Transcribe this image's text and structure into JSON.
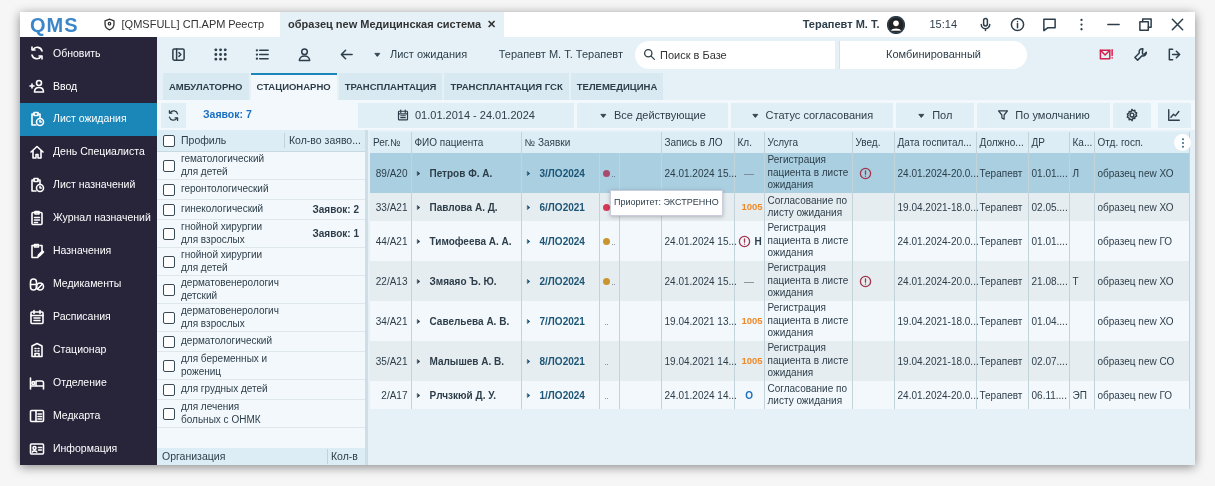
{
  "titlebar": {
    "logo": "QMS",
    "tabs": [
      {
        "label": "[QMSFULL] СП.АРМ Реестр",
        "selected": false
      },
      {
        "label": "образец new Медицинская система",
        "selected": true,
        "close": "✕"
      }
    ],
    "user": "Терапевт М. Т.",
    "time": "15:14"
  },
  "sidebar": {
    "items": [
      {
        "label": "Обновить",
        "selected": false
      },
      {
        "label": "Ввод",
        "selected": false
      },
      {
        "label": "Лист ожидания",
        "selected": true
      },
      {
        "label": "День Специалиста",
        "selected": false
      },
      {
        "label": "Лист назначений",
        "selected": false
      },
      {
        "label": "Журнал назначений",
        "selected": false
      },
      {
        "label": "Назначения",
        "selected": false
      },
      {
        "label": "Медикаменты",
        "selected": false
      },
      {
        "label": "Расписания",
        "selected": false
      },
      {
        "label": "Стационар",
        "selected": false
      },
      {
        "label": "Отделение",
        "selected": false
      },
      {
        "label": "Медкарта",
        "selected": false
      },
      {
        "label": "Информация",
        "selected": false
      }
    ]
  },
  "toolbar": {
    "view": "Лист ожидания",
    "user_line": "Терапевт М. Т. Терапевт",
    "search": {
      "placeholder": "Поиск в Базе"
    },
    "search_mode": "Комбинированный"
  },
  "tabs": [
    {
      "label": "АМБУЛАТОРНО",
      "selected": false
    },
    {
      "label": "СТАЦИОНАРНО",
      "selected": true
    },
    {
      "label": "ТРАНСПЛАНТАЦИЯ",
      "selected": false
    },
    {
      "label": "ТРАНСПЛАНТАЦИЯ ГСК",
      "selected": false
    },
    {
      "label": "ТЕЛЕМЕДИЦИНА",
      "selected": false
    }
  ],
  "filters": {
    "count": "Заявок: 7",
    "period": "01.01.2014 - 24.01.2024",
    "dropdowns": [
      "Все действующие",
      "Статус согласования",
      "Пол"
    ],
    "preset": "По умолчанию"
  },
  "profiles": {
    "columns": [
      "Профиль",
      "Кол-во заяво..."
    ],
    "all_checked": false,
    "rows": [
      {
        "lines": [
          "гематологический",
          "для детей"
        ],
        "count": "",
        "checked": false
      },
      {
        "lines": [
          "геронтологический"
        ],
        "count": "",
        "checked": false
      },
      {
        "lines": [
          "гинекологический"
        ],
        "count": "Заявок: 2",
        "checked": false
      },
      {
        "lines": [
          "гнойной хирургии",
          "для взрослых"
        ],
        "count": "Заявок: 1",
        "checked": false
      },
      {
        "lines": [
          "гнойной хирургии",
          "для детей"
        ],
        "count": "",
        "checked": false
      },
      {
        "lines": [
          "дерматовенерологич",
          "детский"
        ],
        "count": "",
        "checked": false
      },
      {
        "lines": [
          "дерматовенерологич",
          "для взрослых"
        ],
        "count": "",
        "checked": false
      },
      {
        "lines": [
          "дерматологический"
        ],
        "count": "",
        "checked": false
      },
      {
        "lines": [
          "для беременных и",
          "рожениц"
        ],
        "count": "",
        "checked": false
      },
      {
        "lines": [
          "для грудных детей"
        ],
        "count": "",
        "checked": false
      },
      {
        "lines": [
          "для лечения",
          "больных с ОНМК"
        ],
        "count": "",
        "checked": false
      }
    ],
    "footer": [
      "Организация",
      "Кол-в"
    ]
  },
  "table": {
    "columns": [
      "Рег.№",
      "ФИО пациента",
      "№ Заявки",
      "Запись в ЛО",
      "Кл.",
      "Услуга",
      "Увед.",
      "Дата госпитал...",
      "Должно...",
      "ДР",
      "Ка...",
      "Отд. госп."
    ],
    "rows": [
      {
        "selected": true,
        "reg": "89/А20",
        "patient": "Петров Ф. А.",
        "request": "3/ЛО2024",
        "color": "#a84a6e",
        "mark": "..",
        "record": "24.01.2024 15...",
        "cl": {
          "kind": "dash",
          "text": "—"
        },
        "service": "Регистрация пациента в листе ожидания",
        "notice": true,
        "hosp": "24.01.2024-20.0...",
        "position": "Терапевт",
        "dob": "01.01....",
        "cat": "Л",
        "dept": "образец new ХО"
      },
      {
        "selected": false,
        "reg": "33/А21",
        "patient": "Павлова А. Д.",
        "request": "6/ЛО2021",
        "color": "#d63a56",
        "cl": {
          "kind": "code",
          "text": "1005"
        },
        "service": "Согласование по листу ожидания",
        "notice": false,
        "hosp": "19.04.2021-18.0...",
        "position": "Терапевт",
        "dob": "02.05....",
        "dept": "образец new ХО"
      },
      {
        "selected": false,
        "reg": "44/А21",
        "patient": "Тимофеева А. А.",
        "request": "4/ЛО2024",
        "color": "#c8952e",
        "mark": "..",
        "record": "24.01.2024 15...",
        "cl": {
          "kind": "alert",
          "text": "Н"
        },
        "service": "Регистрация пациента в листе ожидания",
        "notice": false,
        "hosp": "24.01.2024-20.0...",
        "position": "Терапевт",
        "dob": "01.01....",
        "dept": "образец new ГО"
      },
      {
        "selected": false,
        "reg": "22/А13",
        "patient": "Змяаяо Ъ. Ю.",
        "request": "2/ЛО2024",
        "color": "#c8952e",
        "mark": "..",
        "record": "24.01.2024 15...",
        "cl": {
          "kind": "dash",
          "text": "—"
        },
        "service": "Регистрация пациента в листе ожидания",
        "notice": true,
        "hosp": "24.01.2024-20.0...",
        "position": "Терапевт",
        "dob": "21.08....",
        "cat": "Т",
        "dept": "образец new ХО"
      },
      {
        "selected": false,
        "reg": "34/А21",
        "patient": "Савельева А. В.",
        "request": "7/ЛО2021",
        "mark": "..",
        "record": "19.04.2021 13...",
        "cl": {
          "kind": "code",
          "text": "1005"
        },
        "service": "Регистрация пациента в листе ожидания",
        "notice": false,
        "hosp": "19.04.2021-18.0...",
        "position": "Терапевт",
        "dob": "01.04....",
        "dept": "образец new ХО"
      },
      {
        "selected": false,
        "reg": "35/А21",
        "patient": "Малышев А. В.",
        "request": "8/ЛО2021",
        "mark": "..",
        "record": "19.04.2021 14...",
        "cl": {
          "kind": "code",
          "text": "1005"
        },
        "service": "Регистрация пациента в листе ожидания",
        "notice": false,
        "hosp": "19.04.2021-18.0...",
        "position": "Терапевт",
        "dob": "02.07....",
        "dept": "образец new СО"
      },
      {
        "selected": false,
        "reg": "2/А17",
        "patient": "Рлчзкюй Д. У.",
        "request": "1/ЛО2024",
        "mark": "..",
        "record": "24.01.2024 14...",
        "cl": {
          "kind": "letter",
          "text": "О"
        },
        "service": "Согласование по листу ожидания",
        "notice": false,
        "hosp": "24.01.2024-20.0...",
        "position": "Терапевт",
        "dob": "06.11....",
        "cat": "ЭП",
        "dept": "образец new ГО"
      }
    ],
    "tooltip": "Приоритет: ЭКСТРЕННО"
  }
}
